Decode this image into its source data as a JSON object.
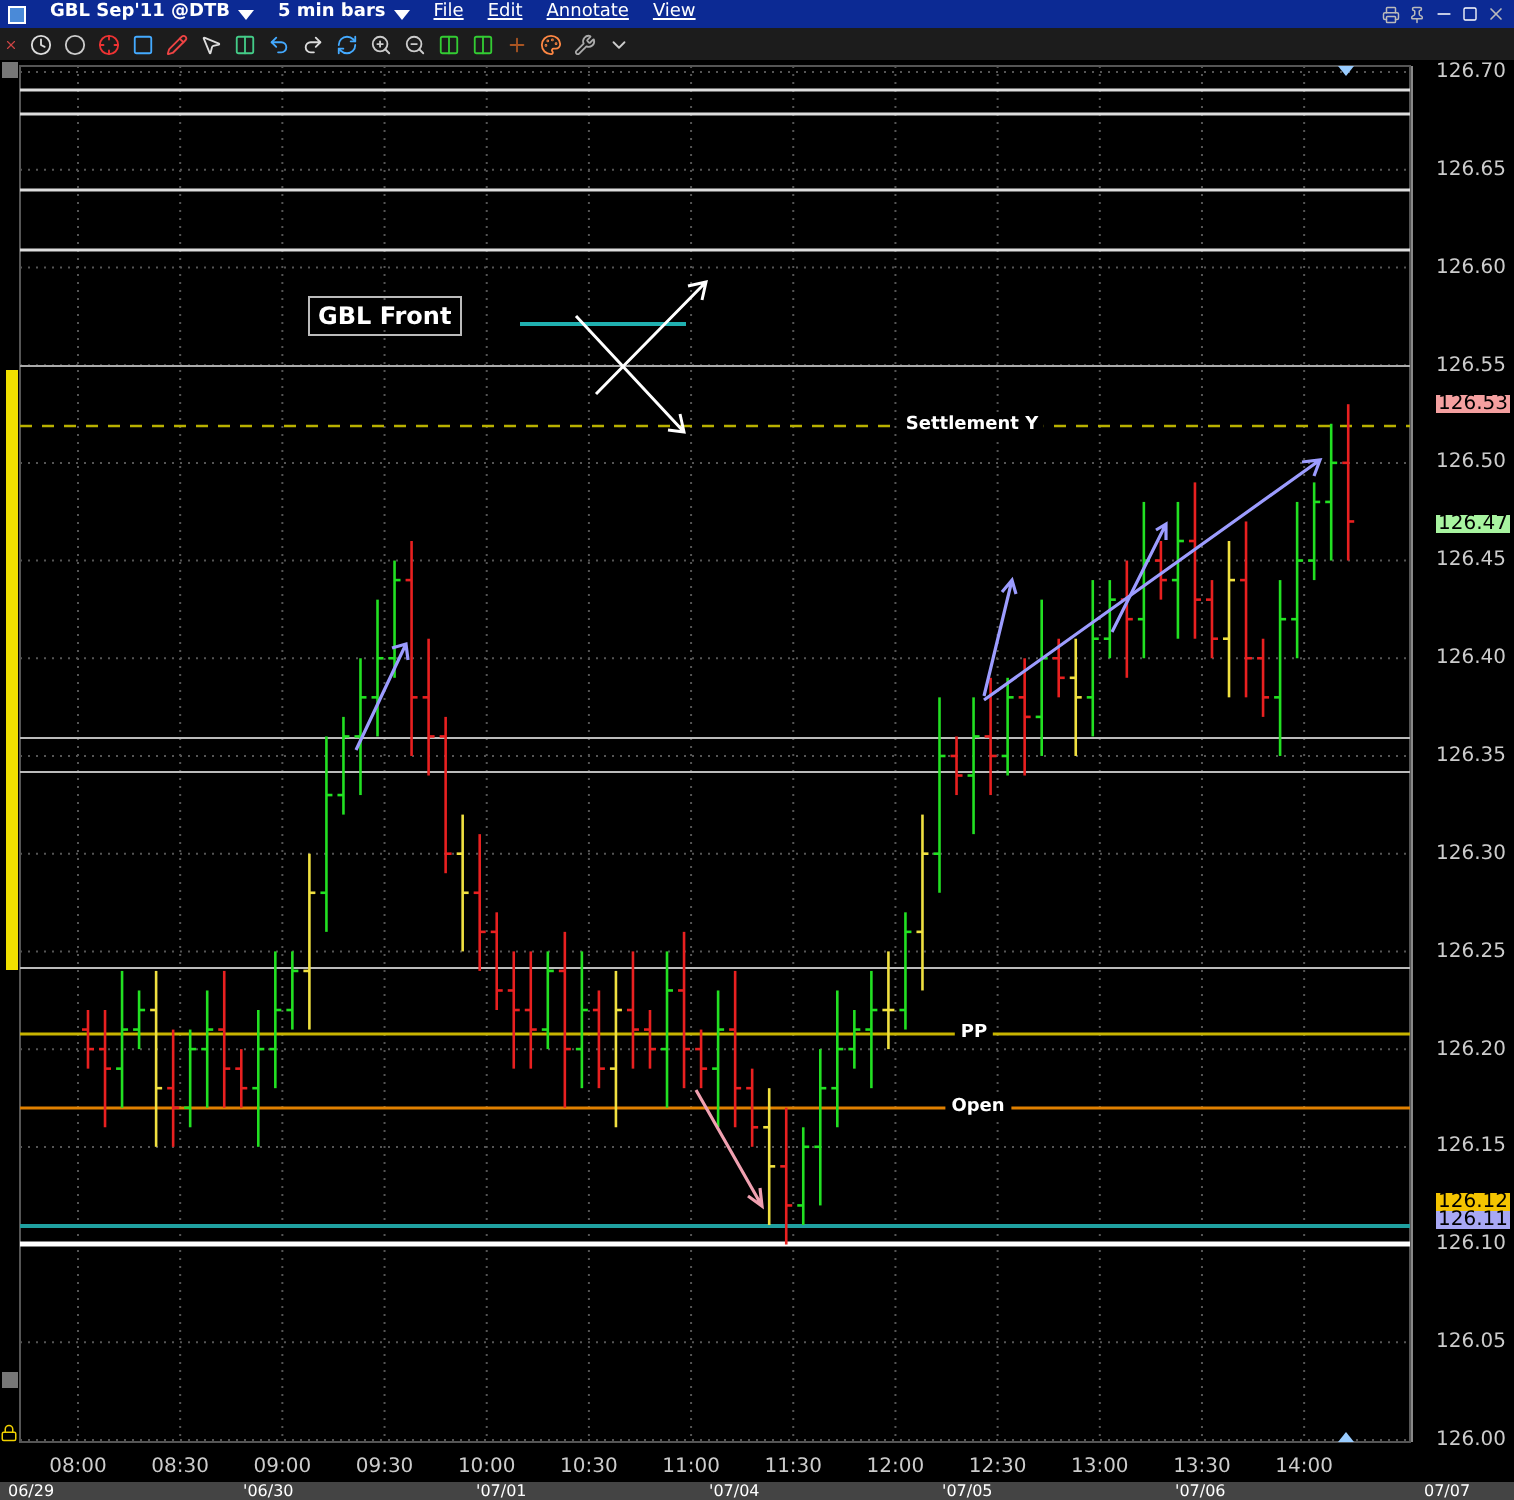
{
  "window": {
    "symbol": "GBL Sep'11 @DTB",
    "bar_size": "5 min bars",
    "menu": [
      "File",
      "Edit",
      "Annotate",
      "View"
    ]
  },
  "annotation": {
    "text": "GBL Front"
  },
  "level_labels": [
    {
      "kind": "settlement",
      "text": "Settlement Y"
    },
    {
      "kind": "pp",
      "text": "PP"
    },
    {
      "kind": "open",
      "text": "Open"
    }
  ],
  "price_tags": [
    {
      "text": "126.53",
      "color": "#f4a0a0"
    },
    {
      "text": "126.47",
      "color": "#a8f4a0"
    },
    {
      "text": "126.12",
      "color": "#f4c400"
    },
    {
      "text": "126.11",
      "color": "#a8a8f4"
    }
  ],
  "y_labels": [
    "126.70",
    "126.65",
    "126.60",
    "126.55",
    "126.50",
    "126.45",
    "126.40",
    "126.35",
    "126.30",
    "126.25",
    "126.20",
    "126.15",
    "126.10",
    "126.05",
    "126.00"
  ],
  "x_labels": [
    "08:00",
    "08:30",
    "09:00",
    "09:30",
    "10:00",
    "10:30",
    "11:00",
    "11:30",
    "12:00",
    "12:30",
    "13:00",
    "13:30",
    "14:00"
  ],
  "date_labels": [
    "06/29",
    "'06/30",
    "'07/01",
    "'07/04",
    "'07/05",
    "'07/06",
    "07/07"
  ]
}
